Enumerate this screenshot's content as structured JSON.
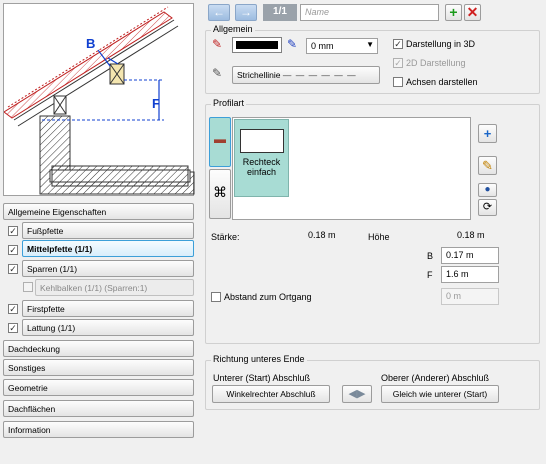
{
  "toolbar": {
    "prev_icon": "arrow-left-icon",
    "next_icon": "arrow-right-icon",
    "page_count": "1/1",
    "name_placeholder": "Name",
    "add_icon": "plus-icon",
    "delete_icon": "delete-x-icon"
  },
  "left_panel": {
    "items": [
      {
        "label": "Allgemeine Eigenschaften"
      },
      {
        "label": "Fußpfette",
        "checked": true
      },
      {
        "label": "Mittelpfette (1/1)",
        "checked": true
      },
      {
        "label": "Sparren (1/1)",
        "checked": true
      },
      {
        "label": "Kehlbalken (1/1) (Sparren:1)",
        "checked": false
      },
      {
        "label": "Firstpfette",
        "checked": true
      },
      {
        "label": "Lattung (1/1)",
        "checked": true
      },
      {
        "label": "Dachdeckung"
      },
      {
        "label": "Sonstiges"
      },
      {
        "label": "Geometrie"
      },
      {
        "label": "Dachflächen"
      },
      {
        "label": "Information"
      }
    ],
    "preview_labels": {
      "b": "B",
      "f": "F"
    }
  },
  "allgemein": {
    "title": "Allgemein",
    "pen_thickness": "0 mm",
    "line_style_label": "Strichellinie",
    "show_3d": "Darstellung in 3D",
    "show_2d": "2D Darstellung",
    "show_axes": "Achsen darstellen"
  },
  "profilart": {
    "title": "Profilart",
    "selected_label_line1": "Rechteck",
    "selected_label_line2": "einfach",
    "staerke_label": "Stärke:",
    "staerke_value": "0.18 m",
    "hoehe_label": "Höhe",
    "hoehe_value": "0.18 m",
    "b_label": "B",
    "b_value": "0.17 m",
    "f_label": "F",
    "f_value": "1.6 m",
    "abstand_label": "Abstand zum Ortgang",
    "abstand_value": "0 m"
  },
  "richtung": {
    "title": "Richtung unteres Ende",
    "lower_label": "Unterer (Start) Abschluß",
    "upper_label": "Oberer (Anderer) Abschluß",
    "lower_button": "Winkelrechter Abschluß",
    "upper_button": "Gleich wie unterer (Start)"
  },
  "colors": {
    "accent": "#3c9fd8",
    "profile_selected": "#a8dcd4"
  }
}
